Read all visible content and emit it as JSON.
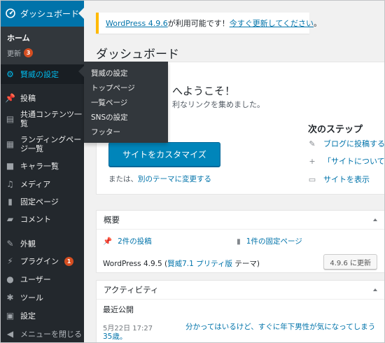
{
  "sidebar": {
    "dashboard": "ダッシュボード",
    "home": "ホーム",
    "updates": "更新",
    "updates_count": "3",
    "items": [
      {
        "label": "賢威の設定",
        "icon": "gear-icon"
      },
      {
        "label": "投稿",
        "icon": "pin-icon"
      },
      {
        "label": "共通コンテンツ一覧",
        "icon": "document-icon"
      },
      {
        "label": "ランディングページ一覧",
        "icon": "layout-icon"
      },
      {
        "label": "キャラ一覧",
        "icon": "camera-icon"
      },
      {
        "label": "メディア",
        "icon": "media-icon"
      },
      {
        "label": "固定ページ",
        "icon": "page-icon"
      },
      {
        "label": "コメント",
        "icon": "comment-icon"
      },
      {
        "label": "外観",
        "icon": "brush-icon"
      },
      {
        "label": "プラグイン",
        "icon": "plug-icon",
        "badge": "1"
      },
      {
        "label": "ユーザー",
        "icon": "user-icon"
      },
      {
        "label": "ツール",
        "icon": "wrench-icon"
      },
      {
        "label": "設定",
        "icon": "settings-icon"
      },
      {
        "label": "メニューを閉じる",
        "icon": "collapse-icon"
      }
    ]
  },
  "flyout": [
    "賢威の設定",
    "トップページ",
    "一覧ページ",
    "SNSの設定",
    "フッター"
  ],
  "notice": {
    "link": "WordPress 4.9.6",
    "text": " が利用可能です！",
    "action": "今すぐ更新してください",
    "end": "。"
  },
  "page_title": "ダッシュボード",
  "welcome": {
    "heading": "へようこそ！",
    "subtitle": "利なリンクを集めました。",
    "button": "サイトをカスタマイズ",
    "or_text": "または、",
    "or_link": "別のテーマに変更する",
    "next_heading": "次のステップ",
    "next_items": [
      "ブログに投稿する",
      "「サイトについて」",
      "サイトを表示"
    ]
  },
  "glance": {
    "title": "概要",
    "posts": "2件の投稿",
    "pages": "1件の固定ページ",
    "version_prefix": "WordPress 4.9.5 (",
    "theme_link": "賢威7.1 プリティ版",
    "version_suffix": " テーマ)",
    "update_button": "4.9.6 に更新"
  },
  "activity": {
    "title": "アクティビティ",
    "recent": "最近公開",
    "date": "5月22日 17:27",
    "post_title": "分かってはいるけど、すぐに年下男性が気になってしまう35歳。"
  },
  "colors": {
    "sidebar_bg": "#23282d",
    "active_bg": "#0073aa",
    "button_bg": "#0085ba",
    "notice_border": "#ffb900",
    "badge": "#d54e21"
  }
}
